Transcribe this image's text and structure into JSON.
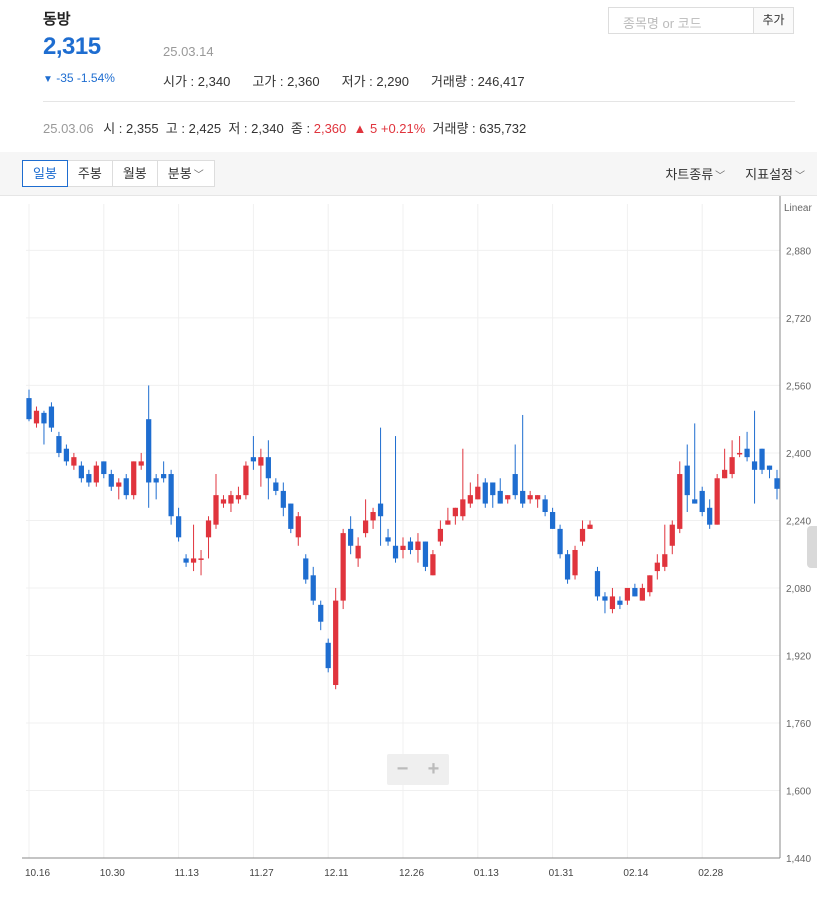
{
  "stock": {
    "name": "동방",
    "price": "2,315",
    "date": "25.03.14",
    "change": "-35 -1.54%",
    "change_arrow": "▼",
    "stats": [
      {
        "label": "시가",
        "value": "2,340"
      },
      {
        "label": "고가",
        "value": "2,360"
      },
      {
        "label": "저가",
        "value": "2,290"
      },
      {
        "label": "거래량",
        "value": "246,417"
      }
    ]
  },
  "search": {
    "placeholder": "종목명 or 코드",
    "add_label": "추가"
  },
  "prev_day": {
    "date": "25.03.06",
    "open": "시 : 2,355",
    "high": "고 : 2,425",
    "low": "저 : 2,340",
    "close_label": "종 :",
    "close_value": "2,360",
    "change_arrow": "▲",
    "change": "5 +0.21%",
    "volume": "거래량 : 635,732"
  },
  "tabs": [
    {
      "label": "일봉",
      "active": true
    },
    {
      "label": "주봉"
    },
    {
      "label": "월봉"
    },
    {
      "label": "분봉",
      "chevron": "﹀"
    }
  ],
  "menus": {
    "chart_type": "차트종류",
    "indicator": "지표설정",
    "chevron": "﹀"
  },
  "zoom": {
    "minus": "−",
    "plus": "+"
  },
  "colors": {
    "up": "#e0343d",
    "down": "#1e6dd0",
    "grid": "#f0f0f0",
    "accent": "#1e6dd0"
  },
  "chart_data": {
    "type": "candlestick",
    "scale": "Linear",
    "ylim": [
      1440,
      2990
    ],
    "yticks": [
      "2,880",
      "2,720",
      "2,560",
      "2,400",
      "2,240",
      "2,080",
      "1,920",
      "1,760",
      "1,600",
      "1,440"
    ],
    "ytick_values": [
      2880,
      2720,
      2560,
      2400,
      2240,
      2080,
      1920,
      1760,
      1600,
      1440
    ],
    "xticks": [
      {
        "label": "10.16",
        "index": 0
      },
      {
        "label": "10.30",
        "index": 10
      },
      {
        "label": "11.13",
        "index": 20
      },
      {
        "label": "11.27",
        "index": 30
      },
      {
        "label": "12.11",
        "index": 40
      },
      {
        "label": "12.26",
        "index": 50
      },
      {
        "label": "01.13",
        "index": 60
      },
      {
        "label": "01.31",
        "index": 70
      },
      {
        "label": "02.14",
        "index": 80
      },
      {
        "label": "02.28",
        "index": 90
      }
    ],
    "candles": [
      [
        2530,
        2480,
        2550,
        2475
      ],
      [
        2470,
        2500,
        2510,
        2460
      ],
      [
        2495,
        2470,
        2500,
        2420
      ],
      [
        2510,
        2460,
        2520,
        2450
      ],
      [
        2440,
        2400,
        2450,
        2390
      ],
      [
        2410,
        2380,
        2420,
        2370
      ],
      [
        2370,
        2390,
        2400,
        2360
      ],
      [
        2370,
        2340,
        2380,
        2330
      ],
      [
        2350,
        2330,
        2360,
        2320
      ],
      [
        2330,
        2370,
        2380,
        2320
      ],
      [
        2380,
        2350,
        2380,
        2340
      ],
      [
        2350,
        2320,
        2360,
        2310
      ],
      [
        2320,
        2330,
        2340,
        2290
      ],
      [
        2340,
        2300,
        2350,
        2290
      ],
      [
        2300,
        2380,
        2380,
        2290
      ],
      [
        2370,
        2380,
        2400,
        2360
      ],
      [
        2480,
        2330,
        2560,
        2270
      ],
      [
        2340,
        2330,
        2350,
        2290
      ],
      [
        2350,
        2340,
        2380,
        2330
      ],
      [
        2350,
        2250,
        2360,
        2230
      ],
      [
        2250,
        2200,
        2270,
        2190
      ],
      [
        2150,
        2140,
        2160,
        2130
      ],
      [
        2140,
        2150,
        2230,
        2120
      ],
      [
        2150,
        2150,
        2170,
        2110
      ],
      [
        2200,
        2240,
        2250,
        2150
      ],
      [
        2230,
        2300,
        2350,
        2220
      ],
      [
        2280,
        2290,
        2300,
        2270
      ],
      [
        2280,
        2300,
        2310,
        2260
      ],
      [
        2290,
        2300,
        2320,
        2280
      ],
      [
        2300,
        2370,
        2380,
        2290
      ],
      [
        2390,
        2380,
        2440,
        2360
      ],
      [
        2370,
        2390,
        2410,
        2320
      ],
      [
        2390,
        2340,
        2430,
        2290
      ],
      [
        2330,
        2310,
        2340,
        2300
      ],
      [
        2310,
        2270,
        2330,
        2250
      ],
      [
        2280,
        2220,
        2280,
        2210
      ],
      [
        2200,
        2250,
        2260,
        2180
      ],
      [
        2150,
        2100,
        2160,
        2090
      ],
      [
        2110,
        2050,
        2130,
        2040
      ],
      [
        2040,
        2000,
        2050,
        1980
      ],
      [
        1950,
        1890,
        1960,
        1880
      ],
      [
        1850,
        2050,
        2080,
        1840
      ],
      [
        2050,
        2210,
        2220,
        2030
      ],
      [
        2220,
        2180,
        2250,
        2160
      ],
      [
        2150,
        2180,
        2200,
        2130
      ],
      [
        2210,
        2240,
        2290,
        2200
      ],
      [
        2240,
        2260,
        2270,
        2220
      ],
      [
        2280,
        2250,
        2460,
        2180
      ],
      [
        2200,
        2190,
        2220,
        2180
      ],
      [
        2180,
        2150,
        2440,
        2140
      ],
      [
        2170,
        2180,
        2200,
        2150
      ],
      [
        2190,
        2170,
        2200,
        2160
      ],
      [
        2170,
        2190,
        2210,
        2140
      ],
      [
        2190,
        2130,
        2190,
        2120
      ],
      [
        2110,
        2160,
        2170,
        2110
      ],
      [
        2190,
        2220,
        2240,
        2180
      ],
      [
        2230,
        2240,
        2270,
        2230
      ],
      [
        2250,
        2270,
        2270,
        2230
      ],
      [
        2250,
        2290,
        2410,
        2240
      ],
      [
        2280,
        2300,
        2330,
        2270
      ],
      [
        2290,
        2320,
        2350,
        2290
      ],
      [
        2330,
        2280,
        2340,
        2270
      ],
      [
        2330,
        2300,
        2330,
        2270
      ],
      [
        2310,
        2280,
        2340,
        2280
      ],
      [
        2290,
        2300,
        2300,
        2280
      ],
      [
        2350,
        2300,
        2420,
        2290
      ],
      [
        2310,
        2280,
        2490,
        2270
      ],
      [
        2290,
        2300,
        2310,
        2280
      ],
      [
        2290,
        2300,
        2300,
        2270
      ],
      [
        2290,
        2260,
        2300,
        2250
      ],
      [
        2260,
        2220,
        2270,
        2220
      ],
      [
        2220,
        2160,
        2230,
        2150
      ],
      [
        2160,
        2100,
        2170,
        2090
      ],
      [
        2110,
        2170,
        2180,
        2100
      ],
      [
        2190,
        2220,
        2240,
        2180
      ],
      [
        2220,
        2230,
        2240,
        2220
      ],
      [
        2120,
        2060,
        2130,
        2050
      ],
      [
        2060,
        2050,
        2070,
        2020
      ],
      [
        2030,
        2060,
        2080,
        2020
      ],
      [
        2050,
        2040,
        2060,
        2030
      ],
      [
        2050,
        2080,
        2080,
        2040
      ],
      [
        2080,
        2060,
        2090,
        2060
      ],
      [
        2050,
        2080,
        2090,
        2050
      ],
      [
        2070,
        2110,
        2110,
        2060
      ],
      [
        2120,
        2140,
        2160,
        2100
      ],
      [
        2130,
        2160,
        2230,
        2120
      ],
      [
        2180,
        2230,
        2240,
        2160
      ],
      [
        2220,
        2350,
        2380,
        2210
      ],
      [
        2370,
        2300,
        2420,
        2260
      ],
      [
        2290,
        2280,
        2470,
        2280
      ],
      [
        2310,
        2260,
        2320,
        2250
      ],
      [
        2270,
        2230,
        2290,
        2220
      ],
      [
        2230,
        2340,
        2350,
        2230
      ],
      [
        2340,
        2360,
        2410,
        2340
      ],
      [
        2350,
        2390,
        2430,
        2340
      ],
      [
        2400,
        2400,
        2440,
        2390
      ],
      [
        2410,
        2390,
        2450,
        2380
      ],
      [
        2380,
        2360,
        2500,
        2280
      ],
      [
        2410,
        2360,
        2410,
        2350
      ],
      [
        2370,
        2360,
        2370,
        2340
      ],
      [
        2340,
        2315,
        2360,
        2290
      ]
    ]
  }
}
